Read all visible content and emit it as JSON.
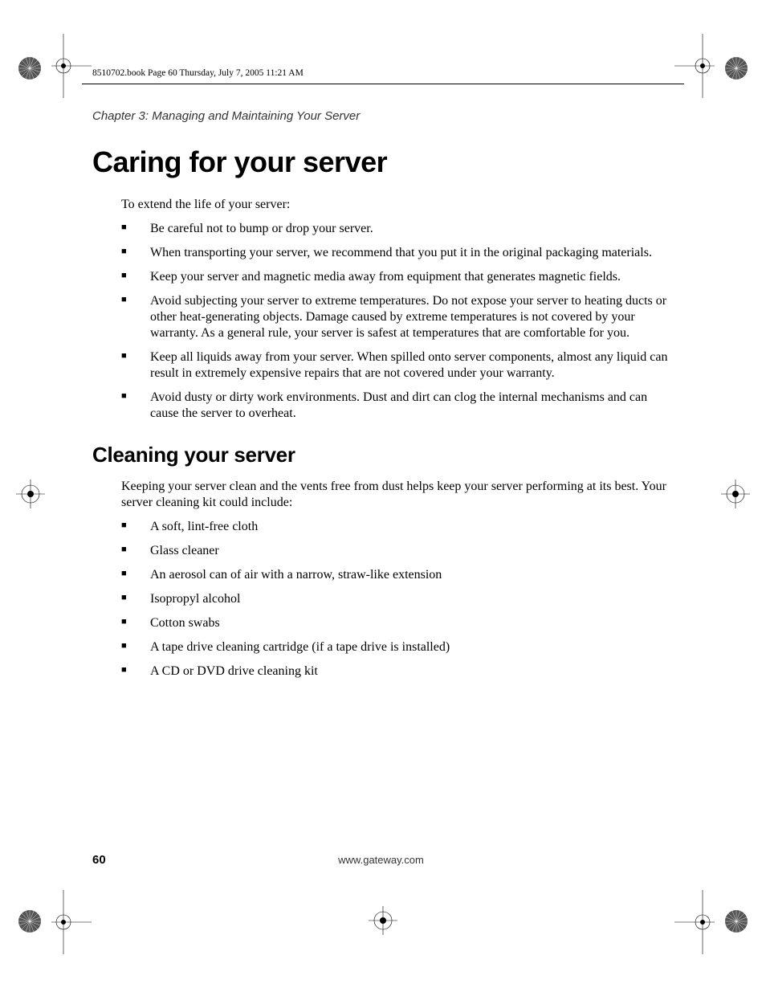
{
  "meta_header": "8510702.book  Page 60  Thursday, July 7, 2005  11:21 AM",
  "chapter": "Chapter 3: Managing and Maintaining Your Server",
  "h1": "Caring for your server",
  "intro1": "To extend the life of your server:",
  "care_bullets": [
    "Be careful not to bump or drop your server.",
    "When transporting your server, we recommend that you put it in the original packaging materials.",
    "Keep your server and magnetic media away from equipment that generates magnetic fields.",
    "Avoid subjecting your server to extreme temperatures. Do not expose your server to heating ducts or other heat-generating objects. Damage caused by extreme temperatures is not covered by your warranty. As a general rule, your server is safest at temperatures that are comfortable for you.",
    "Keep all liquids away from your server. When spilled onto server components, almost any liquid can result in extremely expensive repairs that are not covered under your warranty.",
    "Avoid dusty or dirty work environments. Dust and dirt can clog the internal mechanisms and can cause the server to overheat."
  ],
  "h2": "Cleaning your server",
  "intro2": "Keeping your server clean and the vents free from dust helps keep your server performing at its best. Your server cleaning kit could include:",
  "clean_bullets": [
    "A soft, lint-free cloth",
    "Glass cleaner",
    "An aerosol can of air with a narrow, straw-like extension",
    "Isopropyl alcohol",
    "Cotton swabs",
    "A tape drive cleaning cartridge (if a tape drive is installed)",
    "A CD or DVD drive cleaning kit"
  ],
  "page_number": "60",
  "footer_url": "www.gateway.com"
}
